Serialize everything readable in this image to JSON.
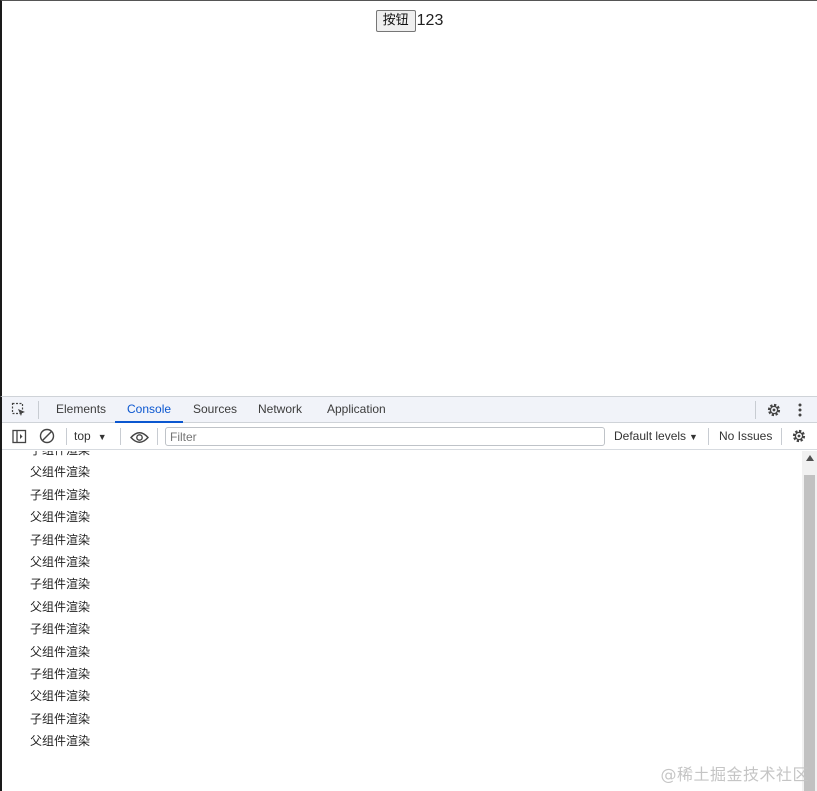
{
  "page": {
    "button_label": "按钮",
    "count_value": "123"
  },
  "devtools": {
    "tabs": [
      {
        "label": "Elements"
      },
      {
        "label": "Console"
      },
      {
        "label": "Sources"
      },
      {
        "label": "Network"
      },
      {
        "label": "Application"
      }
    ],
    "active_tab": "Console",
    "toolbar": {
      "context": "top",
      "filter_placeholder": "Filter",
      "levels_label": "Default levels",
      "issues_label": "No Issues"
    },
    "icons": {
      "inspect": "inspect-element-icon",
      "settings": "gear-icon",
      "more": "kebab-menu-icon",
      "sidebar": "sidebar-toggle-icon",
      "clear": "clear-console-icon",
      "eye": "live-expression-eye-icon"
    },
    "accent_color": "#0b57d0"
  },
  "console": {
    "lines": [
      "子组件渲染",
      "父组件渲染",
      "子组件渲染",
      "父组件渲染",
      "子组件渲染",
      "父组件渲染",
      "子组件渲染",
      "父组件渲染",
      "子组件渲染",
      "父组件渲染",
      "子组件渲染",
      "父组件渲染",
      "子组件渲染",
      "父组件渲染"
    ]
  },
  "watermark": "@稀土掘金技术社区"
}
